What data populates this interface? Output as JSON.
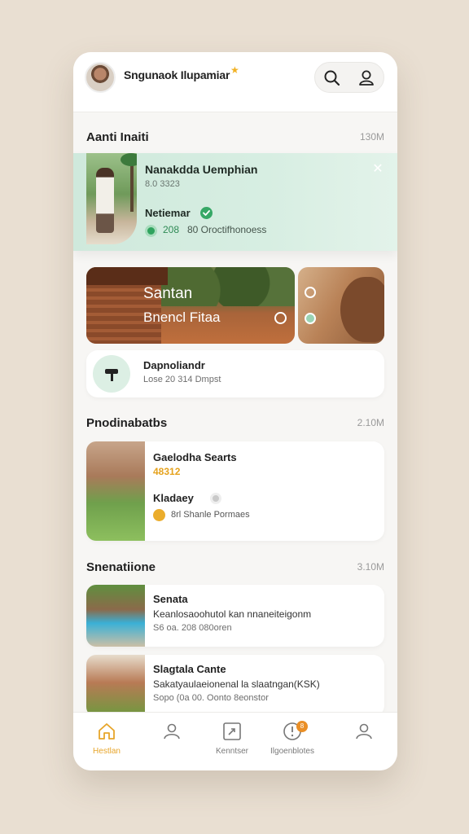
{
  "header": {
    "app_title": "Sngunaok Ilupamiar",
    "icons": [
      "search-icon",
      "user-icon"
    ]
  },
  "sections": {
    "first": {
      "title": "Aanti Inaiti",
      "meta": "130M"
    },
    "second": {
      "title": "Pnodinabatbs",
      "meta": "2.10M"
    },
    "third": {
      "title": "Snenatiione",
      "meta": "3.10M"
    }
  },
  "highlight": {
    "name": "Nanakdda Uemphian",
    "sub": "8.0 3323",
    "label": "Netiemar",
    "stat_value": "208",
    "stat_text": "80 Oroctifhonoess"
  },
  "banner": {
    "title": "Santan",
    "subtitle": "Bnencl Fitaa"
  },
  "info_card": {
    "title": "Dapnoliandr",
    "subtitle": "Lose 20 314 Dmpst"
  },
  "product_card": {
    "title": "Gaelodha Searts",
    "price": "48312",
    "label": "Kladaey",
    "stat": "8rl Shanle Pormaes"
  },
  "list_items": [
    {
      "title": "Senata",
      "subtitle": "Keanlosaoohutol kan nnaneiteigonm",
      "meta": "S6 oa. 208 080oren"
    },
    {
      "title": "Slagtala Cante",
      "subtitle": "Sakatyaulaeionenal la slaatngan(KSK)",
      "meta": "Sopo (0a 00. Oonto 8eonstor"
    }
  ],
  "bottom_nav": [
    {
      "label": "Hestlan",
      "icon": "home-icon",
      "active": true
    },
    {
      "label": "",
      "icon": "profile-icon",
      "active": false
    },
    {
      "label": "Kenntser",
      "icon": "frame-icon",
      "active": false
    },
    {
      "label": "Ilgoenblotes",
      "icon": "notification-icon",
      "active": false,
      "badge": "8"
    },
    {
      "label": "",
      "icon": "account-icon",
      "active": false
    }
  ],
  "colors": {
    "accent": "#e7a52a",
    "mint": "#cfe9dc",
    "green": "#2fa35e"
  }
}
